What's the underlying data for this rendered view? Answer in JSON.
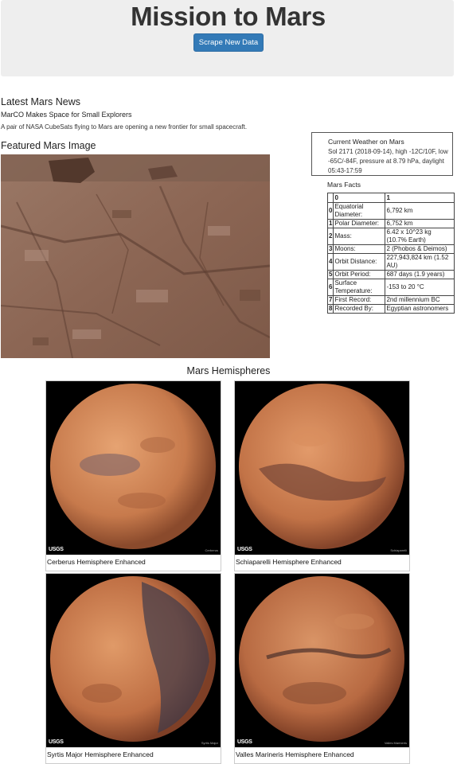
{
  "header": {
    "title": "Mission to Mars",
    "scrape_button": "Scrape New Data"
  },
  "news": {
    "heading": "Latest Mars News",
    "title": "MarCO Makes Space for Small Explorers",
    "paragraph": "A pair of NASA CubeSats flying to Mars are opening a new frontier for small spacecraft."
  },
  "featured": {
    "heading": "Featured Mars Image"
  },
  "weather": {
    "heading": "Current Weather on Mars",
    "text": "Sol 2171 (2018-09-14), high -12C/10F, low -65C/-84F, pressure at 8.79 hPa, daylight 05:43-17:59"
  },
  "facts": {
    "heading": "Mars Facts",
    "columns": [
      "0",
      "1"
    ],
    "rows": [
      [
        "0",
        "Equatorial Diameter:",
        "6,792 km"
      ],
      [
        "1",
        "Polar Diameter:",
        "6,752 km"
      ],
      [
        "2",
        "Mass:",
        "6.42 x 10^23 kg (10.7% Earth)"
      ],
      [
        "3",
        "Moons:",
        "2 (Phobos & Deimos)"
      ],
      [
        "4",
        "Orbit Distance:",
        "227,943,824 km (1.52 AU)"
      ],
      [
        "5",
        "Orbit Period:",
        "687 days (1.9 years)"
      ],
      [
        "6",
        "Surface Temperature:",
        "-153 to 20 °C"
      ],
      [
        "7",
        "First Record:",
        "2nd millennium BC"
      ],
      [
        "8",
        "Recorded By:",
        "Egyptian astronomers"
      ]
    ]
  },
  "hemispheres": {
    "heading": "Mars Hemispheres",
    "usgs": "USGS",
    "items": [
      {
        "caption": "Cerberus Hemisphere Enhanced",
        "credit": "Cerberus"
      },
      {
        "caption": "Schiaparelli Hemisphere Enhanced",
        "credit": "Schiaparelli"
      },
      {
        "caption": "Syrtis Major Hemisphere Enhanced",
        "credit": "Syrtis Major"
      },
      {
        "caption": "Valles Marineris Hemisphere Enhanced",
        "credit": "Valles Marineris"
      }
    ]
  },
  "colors": {
    "button": "#337ab7",
    "jumbotron": "#eeeeee",
    "mars_light": "#d9935f",
    "mars_dark": "#7a3a22"
  }
}
